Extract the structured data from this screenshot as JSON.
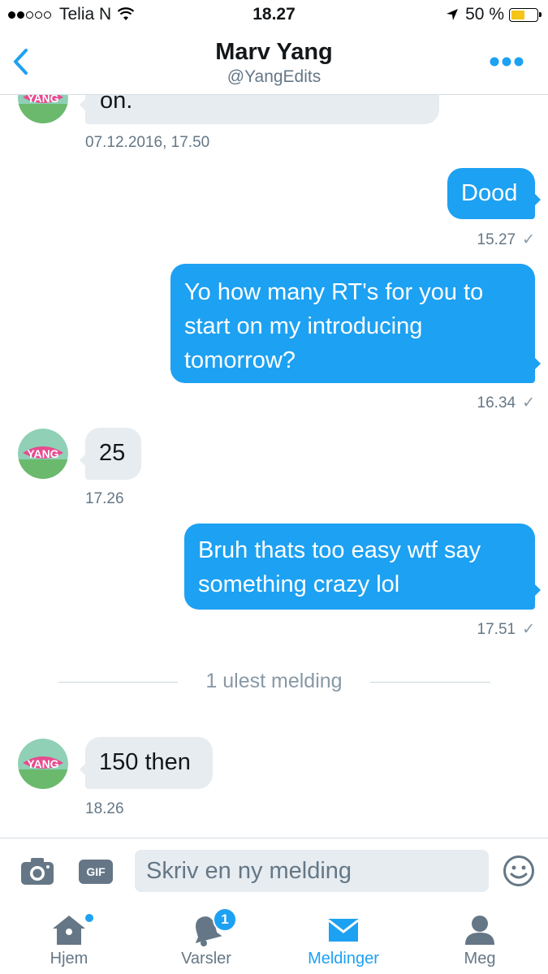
{
  "status_bar": {
    "carrier": "Telia N",
    "time": "18.27",
    "battery": "50 %",
    "battery_level": 0.5
  },
  "header": {
    "name": "Marv Yang",
    "handle": "@YangEdits"
  },
  "conversation": {
    "avatar_text": "YANG",
    "messages": [
      {
        "dir": "in",
        "text": "on.",
        "meta": "07.12.2016, 17.50"
      },
      {
        "dir": "out",
        "text": "Dood",
        "meta": "15.27"
      },
      {
        "dir": "out",
        "lines": [
          "Yo how many RT's for you to",
          "start on my introducing",
          "tomorrow?"
        ],
        "meta": "16.34"
      },
      {
        "dir": "in",
        "text": "25",
        "meta": "17.26"
      },
      {
        "dir": "out",
        "lines": [
          "Bruh thats too easy wtf say",
          "something crazy lol"
        ],
        "meta": "17.51"
      },
      {
        "dir": "in",
        "text": "150 then",
        "meta": "18.26"
      }
    ],
    "unread_divider": "1 ulest melding"
  },
  "composer": {
    "gif_label": "GIF",
    "placeholder": "Skriv en ny melding"
  },
  "tabs": [
    {
      "label": "Hjem",
      "icon": "home-icon"
    },
    {
      "label": "Varsler",
      "icon": "bell-icon",
      "badge": "1"
    },
    {
      "label": "Meldinger",
      "icon": "envelope-icon",
      "active": true
    },
    {
      "label": "Meg",
      "icon": "person-icon"
    }
  ],
  "colors": {
    "accent": "#1da1f2",
    "incoming_bubble": "#e6ecf0",
    "muted_text": "#657786"
  }
}
